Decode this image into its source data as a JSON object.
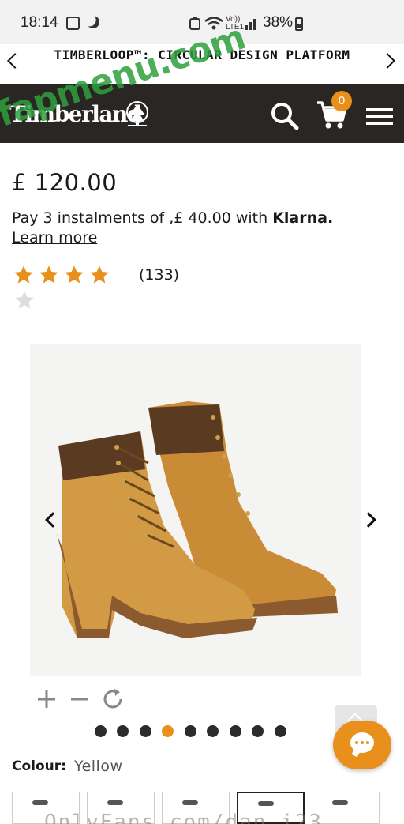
{
  "status_bar": {
    "time": "18:14",
    "signal_label": "Vo)) LTE1",
    "battery": "38%"
  },
  "banner": {
    "title": "TIMBERLOOP™: CIRCULAR DESIGN PLATFORM"
  },
  "header": {
    "logo": "Timberland",
    "cart_count": "0"
  },
  "watermark": {
    "text": "fapmenu.com"
  },
  "product": {
    "price": "£ 120.00",
    "klarna_prefix": "Pay 3 instalments of ,£ 40.00 with ",
    "klarna_brand": "Klarna.",
    "learn_more": "Learn more",
    "rating": 4,
    "rating_max": 5,
    "review_count": "(133)",
    "image_icon": "boots-photo"
  },
  "gallery": {
    "total_images": 9,
    "active_index": 3
  },
  "colour": {
    "label": "Colour:",
    "value": "Yellow"
  },
  "swatches": {
    "count": 5,
    "selected_index": 3
  },
  "url_overlay": {
    "text": "OnlyFans.com/dan_i23"
  },
  "colors": {
    "accent": "#e8901b",
    "header_bg": "#2a2624",
    "star": "#e8901b",
    "watermark": "#2ea03c"
  }
}
